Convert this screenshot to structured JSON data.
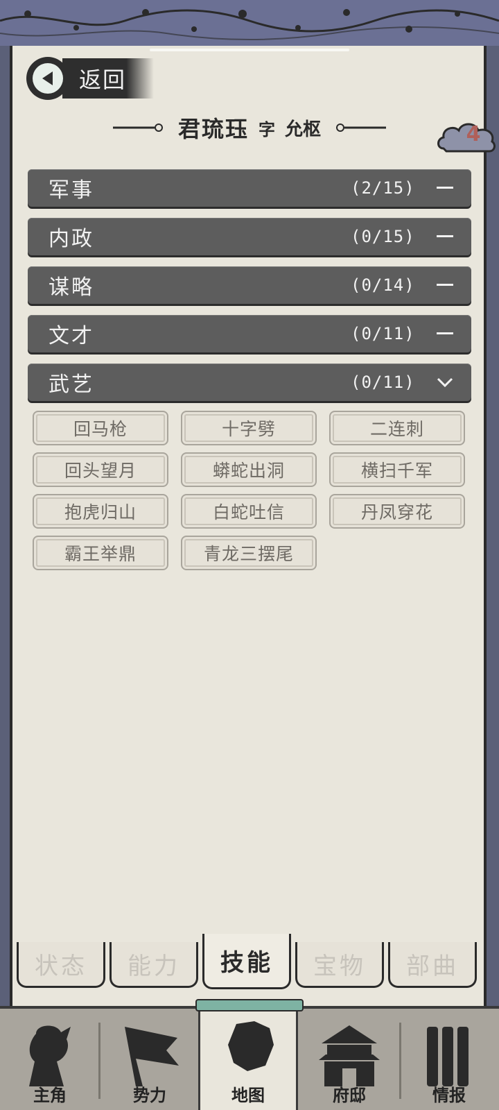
{
  "header": {
    "back_label": "返回",
    "name": "君琉珏",
    "zi_label": "字",
    "style_name": "允枢",
    "badge_count": "4"
  },
  "categories": [
    {
      "name": "军事",
      "count": "(2/15)",
      "state": "collapsed"
    },
    {
      "name": "内政",
      "count": "(0/15)",
      "state": "collapsed"
    },
    {
      "name": "谋略",
      "count": "(0/14)",
      "state": "collapsed"
    },
    {
      "name": "文才",
      "count": "(0/11)",
      "state": "collapsed"
    },
    {
      "name": "武艺",
      "count": "(0/11)",
      "state": "expanded"
    }
  ],
  "skills": [
    "回马枪",
    "十字劈",
    "二连刺",
    "回头望月",
    "蟒蛇出洞",
    "横扫千军",
    "抱虎归山",
    "白蛇吐信",
    "丹凤穿花",
    "霸王举鼎",
    "青龙三摆尾"
  ],
  "tabs": [
    {
      "label": "状态",
      "active": false
    },
    {
      "label": "能力",
      "active": false
    },
    {
      "label": "技能",
      "active": true
    },
    {
      "label": "宝物",
      "active": false
    },
    {
      "label": "部曲",
      "active": false
    }
  ],
  "bottom_nav": [
    {
      "label": "主角",
      "icon": "hero-icon",
      "active": false
    },
    {
      "label": "势力",
      "icon": "flag-icon",
      "active": false
    },
    {
      "label": "地图",
      "icon": "map-icon",
      "active": true
    },
    {
      "label": "府邸",
      "icon": "mansion-icon",
      "active": false
    },
    {
      "label": "情报",
      "icon": "scroll-icon",
      "active": false
    }
  ],
  "colors": {
    "frame": "#5c607a",
    "paper": "#e9e6dc",
    "category_bg": "#5d5d5d",
    "badge_text": "#b0605a",
    "nav_bg": "#a9a59d",
    "active_cap": "#7eb3a3"
  }
}
